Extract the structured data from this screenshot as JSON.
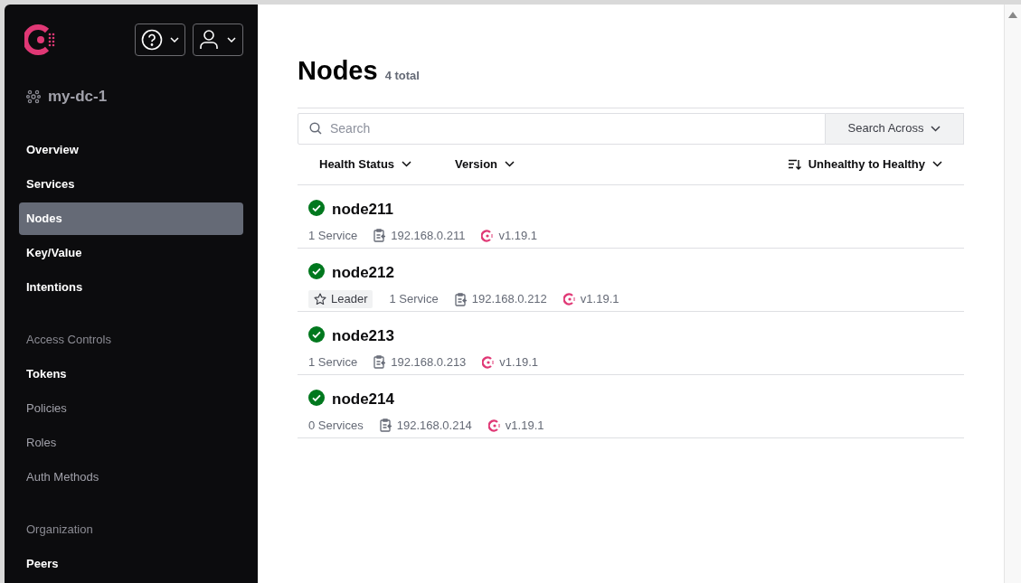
{
  "sidebar": {
    "datacenter": "my-dc-1",
    "items": [
      {
        "kind": "link",
        "label": "Overview",
        "selected": false,
        "disabled": false
      },
      {
        "kind": "link",
        "label": "Services",
        "selected": false,
        "disabled": false
      },
      {
        "kind": "link",
        "label": "Nodes",
        "selected": true,
        "disabled": false
      },
      {
        "kind": "link",
        "label": "Key/Value",
        "selected": false,
        "disabled": false
      },
      {
        "kind": "link",
        "label": "Intentions",
        "selected": false,
        "disabled": false
      },
      {
        "kind": "heading",
        "label": "Access Controls"
      },
      {
        "kind": "link",
        "label": "Tokens",
        "selected": false,
        "disabled": false
      },
      {
        "kind": "link",
        "label": "Policies",
        "selected": false,
        "disabled": true
      },
      {
        "kind": "link",
        "label": "Roles",
        "selected": false,
        "disabled": true
      },
      {
        "kind": "link",
        "label": "Auth Methods",
        "selected": false,
        "disabled": true
      },
      {
        "kind": "heading",
        "label": "Organization"
      },
      {
        "kind": "link",
        "label": "Peers",
        "selected": false,
        "disabled": false
      }
    ]
  },
  "page": {
    "title": "Nodes",
    "count": "4 total"
  },
  "search": {
    "placeholder": "Search",
    "scope_button": "Search Across"
  },
  "filters": [
    "Health Status",
    "Version"
  ],
  "sort": "Unhealthy to Healthy",
  "nodes": [
    {
      "name": "node211",
      "healthy": true,
      "services": "1 Service",
      "address": "192.168.0.211",
      "version": "v1.19.1"
    },
    {
      "name": "node212",
      "healthy": true,
      "leader": "Leader",
      "services": "1 Service",
      "address": "192.168.0.212",
      "version": "v1.19.1"
    },
    {
      "name": "node213",
      "healthy": true,
      "services": "1 Service",
      "address": "192.168.0.213",
      "version": "v1.19.1"
    },
    {
      "name": "node214",
      "healthy": true,
      "services": "0 Services",
      "address": "192.168.0.214",
      "version": "v1.19.1"
    }
  ]
}
